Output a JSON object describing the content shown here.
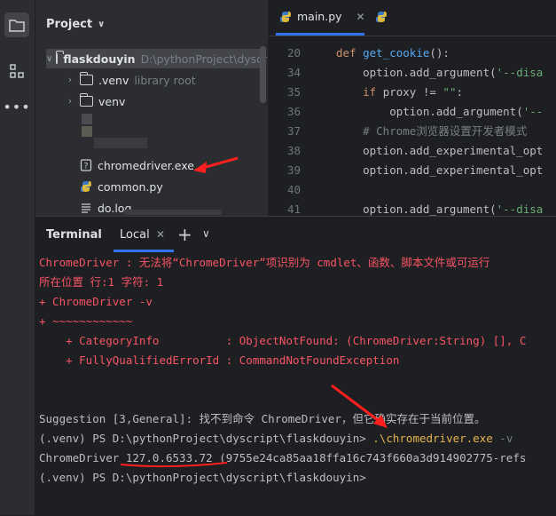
{
  "project_panel": {
    "title": "Project",
    "tree": [
      {
        "label": "flaskdouyin",
        "hint": "D:\\pythonProject\\dyscri"
      },
      {
        "label": ".venv",
        "hint": "library root"
      },
      {
        "label": "venv",
        "hint": ""
      },
      {
        "label": "chromedriver.exe",
        "hint": ""
      },
      {
        "label": "common.py",
        "hint": ""
      },
      {
        "label": "do.log",
        "hint": ""
      }
    ]
  },
  "editor": {
    "tab_label": "main.py",
    "lines": [
      {
        "num": "20",
        "parts": [
          [
            "kw",
            "def "
          ],
          [
            "fn",
            "get_cookie"
          ],
          [
            "txt",
            "():"
          ]
        ]
      },
      {
        "num": "34",
        "parts": [
          [
            "txt",
            "    option.add_argument("
          ],
          [
            "str",
            "'--disa"
          ]
        ]
      },
      {
        "num": "35",
        "parts": [
          [
            "kw",
            "    if "
          ],
          [
            "txt",
            "proxy != "
          ],
          [
            "str",
            "\"\""
          ],
          [
            "txt",
            ":"
          ]
        ]
      },
      {
        "num": "36",
        "parts": [
          [
            "txt",
            "        option.add_argument("
          ],
          [
            "str",
            "'--"
          ]
        ]
      },
      {
        "num": "37",
        "parts": [
          [
            "cmt",
            "    # Chrome浏览器设置开发者模式"
          ]
        ]
      },
      {
        "num": "38",
        "parts": [
          [
            "txt",
            "    option.add_experimental_opt"
          ]
        ]
      },
      {
        "num": "39",
        "parts": [
          [
            "txt",
            "    option.add_experimental_opt"
          ]
        ]
      },
      {
        "num": "40",
        "parts": [
          [
            "txt",
            ""
          ]
        ]
      },
      {
        "num": "41",
        "parts": [
          [
            "txt",
            "    option.add_argument("
          ],
          [
            "str",
            "'--disa"
          ]
        ]
      }
    ]
  },
  "terminal": {
    "title": "Terminal",
    "tab_label": "Local",
    "lines": [
      {
        "cls": "err",
        "text": "ChromeDriver : 无法将“ChromeDriver”项识别为 cmdlet、函数、脚本文件或可运行"
      },
      {
        "cls": "err",
        "text": "所在位置 行:1 字符: 1"
      },
      {
        "cls": "err",
        "text": "+ ChromeDriver -v"
      },
      {
        "cls": "err",
        "text": "+ ~~~~~~~~~~~~"
      },
      {
        "cls": "err",
        "text": "    + CategoryInfo          : ObjectNotFound: (ChromeDriver:String) [], C"
      },
      {
        "cls": "err",
        "text": "    + FullyQualifiedErrorId : CommandNotFoundException"
      },
      {
        "cls": "norm",
        "text": ""
      },
      {
        "cls": "norm",
        "text": ""
      },
      {
        "cls": "norm",
        "text": "Suggestion [3,General]: 找不到命令 ChromeDriver，但它确实存在于当前位置。"
      },
      {
        "cls": "norm",
        "text": "(.venv) PS D:\\pythonProject\\dyscript\\flaskdouyin> "
      },
      {
        "cls": "norm",
        "text": "ChromeDriver 127.0.6533.72 (9755e24ca85aa18ffa16c743f660a3d914902775-refs"
      },
      {
        "cls": "norm",
        "text": "(.venv) PS D:\\pythonProject\\dyscript\\flaskdouyin>"
      }
    ],
    "command": ".\\chromedriver.exe",
    "command_arg": " -v"
  }
}
